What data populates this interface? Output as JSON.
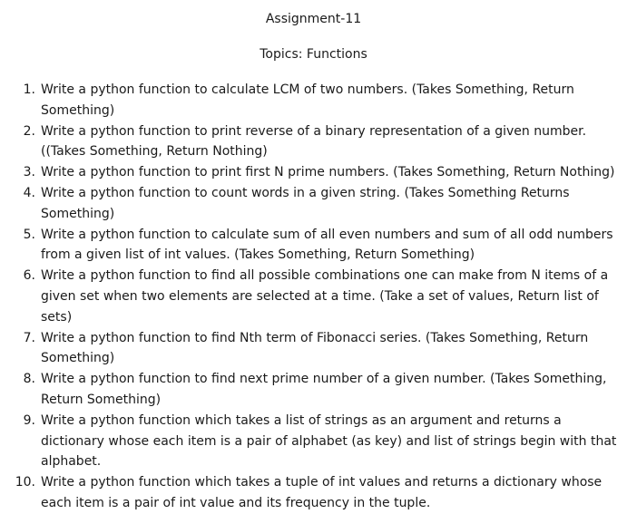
{
  "document": {
    "heading": "Assignment-11",
    "topics": "Topics: Functions",
    "items": [
      {
        "number": "1.",
        "text": "Write a python function to calculate LCM of two numbers. (Takes Something, Return Something)"
      },
      {
        "number": "2.",
        "text": "Write a python function to print reverse of a binary representation of a given number. ((Takes Something, Return Nothing)"
      },
      {
        "number": "3.",
        "text": "Write a python function to print first N prime numbers. (Takes Something, Return Nothing)"
      },
      {
        "number": "4.",
        "text": "Write a python function to count words in a given string. (Takes Something Returns Something)"
      },
      {
        "number": "5.",
        "text": "Write a python function to calculate sum of all even numbers and sum of all odd numbers from a given list of int values. (Takes Something, Return Something)"
      },
      {
        "number": "6.",
        "text": "Write a python function to find all possible combinations one can make from N items of a given set when two elements are selected at a time. (Take a set of values, Return list of sets)"
      },
      {
        "number": "7.",
        "text": "Write a python function to find Nth term of Fibonacci series. (Takes Something, Return Something)"
      },
      {
        "number": "8.",
        "text": "Write a python function to find next prime number of a given number. (Takes Something, Return Something)"
      },
      {
        "number": "9.",
        "text": "Write a python function which takes a list of strings as an argument and returns a dictionary whose each item is a pair of alphabet (as key) and list of strings begin with that alphabet."
      },
      {
        "number": "10.",
        "text": "Write a python function which takes a tuple of int values and returns a dictionary whose each item is a pair of int value and its frequency in the tuple."
      }
    ]
  }
}
